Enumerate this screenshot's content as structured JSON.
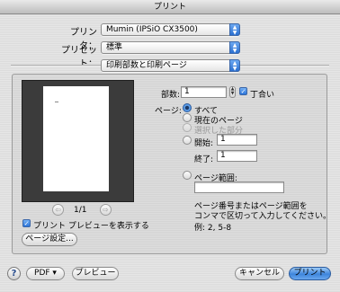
{
  "window": {
    "title": "プリント"
  },
  "printer": {
    "label": "プリンタ：",
    "value": "Mumin (IPSiO CX3500)"
  },
  "preset": {
    "label": "プリセット：",
    "value": "標準"
  },
  "section": {
    "value": "印刷部数と印刷ページ"
  },
  "preview": {
    "page_counter": "1/1",
    "prev_icon": "left-arrow-icon",
    "next_icon": "right-arrow-icon",
    "show_preview_label": "プリント プレビューを表示する",
    "show_preview_checked": true,
    "page_setup_label": "ページ設定..."
  },
  "copies": {
    "label": "部数:",
    "value": "1",
    "collate_label": "丁合い",
    "collate_checked": true
  },
  "pages": {
    "label": "ページ:",
    "all_label": "すべて",
    "current_label": "現在のページ",
    "selection_label": "選択した部分",
    "from_label": "開始:",
    "from_value": "1",
    "to_label": "終了:",
    "to_value": "1",
    "range_label": "ページ範囲:",
    "range_value": "",
    "hint_line1": "ページ番号またはページ範囲を",
    "hint_line2": "コンマで区切って入力してください。",
    "example": "例: 2, 5-8",
    "selected": "all"
  },
  "footer": {
    "help_label": "?",
    "pdf_label": "PDF ▾",
    "preview_label": "プレビュー",
    "cancel_label": "キャンセル",
    "print_label": "プリント"
  },
  "colors": {
    "accent": "#3e85dc",
    "preview_bg": "#3b3b3b"
  }
}
